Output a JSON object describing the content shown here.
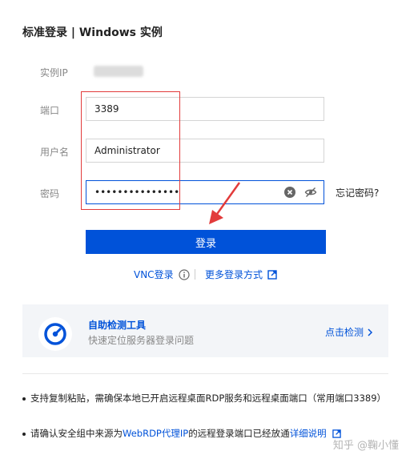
{
  "header": {
    "title": "标准登录 | Windows 实例"
  },
  "form": {
    "ip_label": "实例IP",
    "port_label": "端口",
    "port_value": "3389",
    "user_label": "用户名",
    "user_value": "Administrator",
    "password_label": "密码",
    "password_mask": "•••••••••••••••",
    "forgot_label": "忘记密码?",
    "login_label": "登录"
  },
  "alt_login": {
    "vnc_label": "VNC登录",
    "more_label": "更多登录方式"
  },
  "tool_card": {
    "title": "自助检测工具",
    "subtitle": "快速定位服务器登录问题",
    "action_label": "点击检测"
  },
  "notes": {
    "note1": "支持复制粘贴，需确保本地已开启远程桌面RDP服务和远程桌面端口（常用端口3389）",
    "note2_prefix": "请确认安全组中来源为",
    "note2_link": "WebRDP代理IP",
    "note2_middle": "的远程登录端口已经放通",
    "note2_detail": "详细说明"
  },
  "watermark": "知乎 @鞠小懂",
  "colors": {
    "accent": "#0052d9",
    "annotation": "#e23b3b"
  },
  "icons": [
    "clear-icon",
    "eye-off-icon",
    "info-icon",
    "external-link-icon",
    "gauge-icon",
    "chevron-right-icon",
    "arrow-annotation"
  ]
}
